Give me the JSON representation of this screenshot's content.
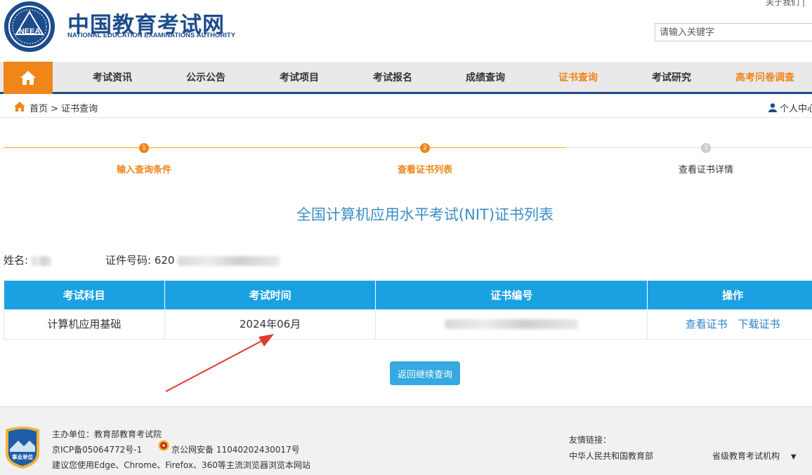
{
  "header": {
    "title": "中国教育考试网",
    "subtitle": "NATIONAL EDUCATION EXAMINATIONS AUTHORITY",
    "logo_text": "NEEA",
    "top_link": "关于我们 | ",
    "search_placeholder": "请输入关键字"
  },
  "nav": {
    "items": [
      {
        "label": "考试资讯",
        "color": "#333333"
      },
      {
        "label": "公示公告",
        "color": "#333333"
      },
      {
        "label": "考试项目",
        "color": "#333333"
      },
      {
        "label": "考试报名",
        "color": "#333333"
      },
      {
        "label": "成绩查询",
        "color": "#333333"
      },
      {
        "label": "证书查询",
        "color": "#f08519"
      },
      {
        "label": "考试研究",
        "color": "#333333"
      },
      {
        "label": "高考问卷调查",
        "color": "#f08519"
      }
    ]
  },
  "breadcrumb": {
    "text": "首页 > 证书查询",
    "user": "个人中心"
  },
  "steps": [
    {
      "num": "1",
      "label": "输入查询条件",
      "state": "done"
    },
    {
      "num": "2",
      "label": "查看证书列表",
      "state": "current"
    },
    {
      "num": "3",
      "label": "查看证书详情",
      "state": "pending"
    }
  ],
  "page_title": "全国计算机应用水平考试(NIT)证书列表",
  "info": {
    "name_label": "姓名:",
    "id_label": "证件号码:",
    "id_value_visible": "620"
  },
  "table": {
    "headers": [
      "考试科目",
      "考试时间",
      "证书编号",
      "操作"
    ],
    "rows": [
      {
        "subject": "计算机应用基础",
        "time": "2024年06月",
        "actions": [
          "查看证书",
          "下载证书"
        ]
      }
    ]
  },
  "back_button": "返回继续查询",
  "footer": {
    "host": "主办单位：教育部教育考试院",
    "icp": "京ICP备05064772号-1",
    "police": "京公网安备 11040202430017号",
    "browser_tip": "建议您使用Edge、Chrome、Firefox、360等主流浏览器浏览本网站",
    "badge_text": "事业单位",
    "friend_title": "友情链接：",
    "friend_link": "中华人民共和国教育部",
    "friend_select": "省级教育考试机构",
    "select_arrow": "▼"
  },
  "colors": {
    "brand_blue": "#1c4c8c",
    "accent_orange": "#f08519",
    "table_header": "#1ba1e2",
    "title_blue": "#3a8ec6"
  }
}
